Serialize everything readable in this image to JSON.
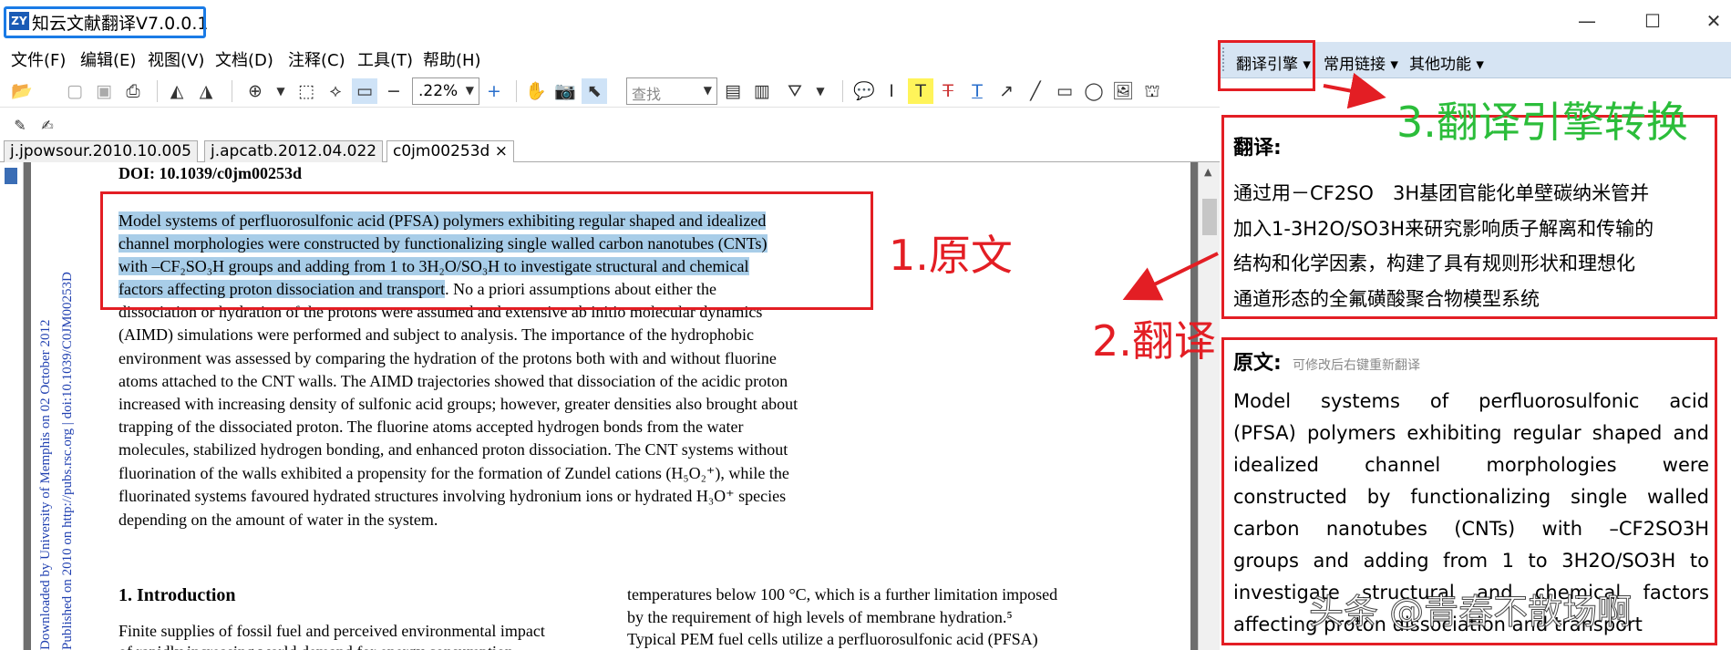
{
  "window": {
    "title": "知云文献翻译V7.0.0.1",
    "logo": "ZY",
    "controls": {
      "minimize": "—",
      "maximize": "☐",
      "close": "✕"
    }
  },
  "menu": [
    "文件(F)",
    "编辑(E)",
    "视图(V)",
    "文档(D)",
    "注释(C)",
    "工具(T)",
    "帮助(H)"
  ],
  "right_panel": {
    "tabs": [
      "翻译引擎 ▾",
      "常用链接 ▾",
      "其他功能 ▾"
    ],
    "translation_label": "翻译:",
    "translation_lines": [
      "通过用－CF2SO　3H基团官能化单壁碳纳米管并",
      "加入1-3H2O/SO3H来研究影响质子解离和传输的",
      "结构和化学因素，构建了具有规则形状和理想化",
      "通道形态的全氟磺酸聚合物模型系统"
    ],
    "original_label": "原文:",
    "original_hint": "可修改后右键重新翻译",
    "original_lines": [
      "Model systems of perfluorosulfonic acid",
      "(PFSA) polymers exhibiting regular shaped and",
      "idealized channel morphologies were",
      "constructed by functionalizing single walled",
      "carbon nanotubes (CNTs) with –CF2SO3H",
      "groups and adding from 1 to 3H2O/SO3H to",
      "investigate structural and chemical factors",
      "affecting proton dissociation and transport"
    ]
  },
  "toolbar": {
    "zoom": ".22%",
    "find_placeholder": "查找"
  },
  "doc_tabs": [
    {
      "label": "j.jpowsour.2010.10.005"
    },
    {
      "label": "j.apcatb.2012.04.022"
    },
    {
      "label": "c0jm00253d ×"
    }
  ],
  "document": {
    "doi": "DOI: 10.1039/c0jm00253d",
    "abstract_highlighted": [
      "Model systems of perfluorosulfonic acid (PFSA) polymers exhibiting regular shaped and idealized",
      "channel morphologies were constructed by functionalizing single walled carbon nanotubes (CNTs)",
      "with –CF₂SO₃H groups and adding from 1 to 3H₂O/SO₃H to investigate structural and chemical",
      "factors affecting proton dissociation and transport"
    ],
    "abstract_rest_first": ". No a priori assumptions about either the",
    "abstract_rest": [
      "dissociation or hydration of the protons were assumed and extensive ab initio molecular dynamics",
      "(AIMD) simulations were performed and subject to analysis. The importance of the hydrophobic",
      "environment was assessed by comparing the hydration of the protons both with and without fluorine",
      "atoms attached to the CNT walls. The AIMD trajectories showed that dissociation of the acidic proton",
      "increased with increasing density of sulfonic acid groups; however, greater densities also brought about",
      "trapping of the dissociated proton. The fluorine atoms accepted hydrogen bonds from the water",
      "molecules, stabilized hydrogen bonding, and enhanced proton dissociation. The CNT systems without",
      "fluorination of the walls exhibited a propensity for the formation of Zundel cations (H₅O₂⁺), while the",
      "fluorinated systems favoured hydrated structures involving hydronium ions or hydrated H₃O⁺ species",
      "depending on the amount of water in the system."
    ],
    "intro_title": "1.    Introduction",
    "col1_lines": [
      "Finite supplies of fossil fuel and perceived environmental impact",
      "of rapidly increasing world demand for energy consumption"
    ],
    "col2_lines": [
      "temperatures below 100 °C, which is a further limitation imposed",
      "by the requirement of high levels of membrane hydration.⁵",
      "   Typical PEM fuel cells utilize a perfluorosulfonic acid (PFSA)"
    ],
    "side_note_1": "Downloaded by University of Memphis on 02 October 2012",
    "side_note_2": "Published on 2010 on http://pubs.rsc.org | doi:10.1039/C0JM00253D"
  },
  "annotations": {
    "label_1": "1.原文",
    "label_2": "2.翻译",
    "label_3": "3.翻译引擎转换",
    "watermark": "头条 @青春不散场啊"
  },
  "colors": {
    "annotation_red": "#e31e24",
    "annotation_green": "#2bbd3a",
    "highlight": "#a8cde8",
    "panel_header": "#d6e4f3"
  }
}
